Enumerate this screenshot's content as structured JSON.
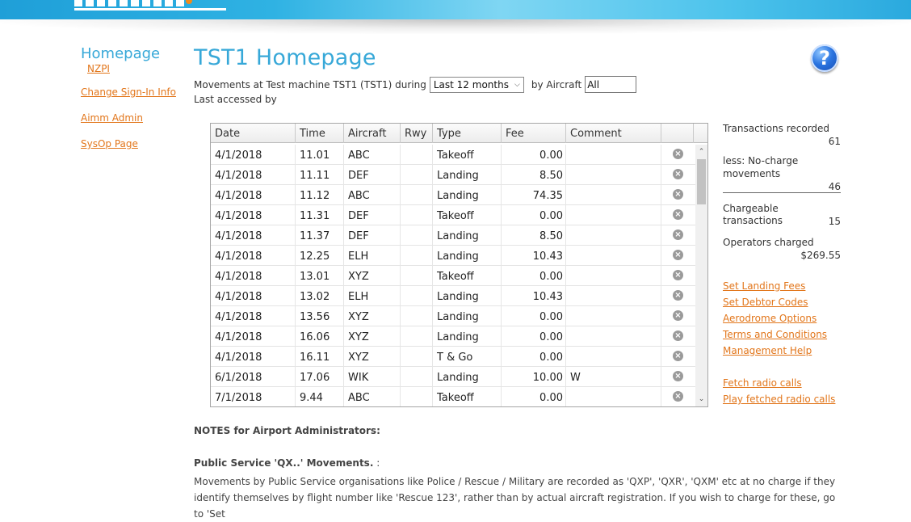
{
  "sidebar": {
    "homepage": "Homepage",
    "airport_code": "NZPI",
    "links": [
      "Change Sign-In Info",
      "Aimm Admin",
      "SysOp Page"
    ]
  },
  "header": {
    "title": "TST1 Homepage",
    "movements_prefix": "Movements at Test machine TST1 (TST1) during",
    "period_value": "Last 12 months",
    "by_aircraft_label": "by Aircraft",
    "aircraft_value": "All",
    "last_accessed": "Last accessed by"
  },
  "table": {
    "columns": [
      "Date",
      "Time",
      "Aircraft",
      "Rwy",
      "Type",
      "Fee",
      "Comment"
    ],
    "rows": [
      {
        "date": "4/1/2018",
        "time": "11.01",
        "aircraft": "ABC",
        "rwy": "",
        "type": "Takeoff",
        "fee": "0.00",
        "comment": ""
      },
      {
        "date": "4/1/2018",
        "time": "11.11",
        "aircraft": "DEF",
        "rwy": "",
        "type": "Landing",
        "fee": "8.50",
        "comment": ""
      },
      {
        "date": "4/1/2018",
        "time": "11.12",
        "aircraft": "ABC",
        "rwy": "",
        "type": "Landing",
        "fee": "74.35",
        "comment": ""
      },
      {
        "date": "4/1/2018",
        "time": "11.31",
        "aircraft": "DEF",
        "rwy": "",
        "type": "Takeoff",
        "fee": "0.00",
        "comment": ""
      },
      {
        "date": "4/1/2018",
        "time": "11.37",
        "aircraft": "DEF",
        "rwy": "",
        "type": "Landing",
        "fee": "8.50",
        "comment": ""
      },
      {
        "date": "4/1/2018",
        "time": "12.25",
        "aircraft": "ELH",
        "rwy": "",
        "type": "Landing",
        "fee": "10.43",
        "comment": ""
      },
      {
        "date": "4/1/2018",
        "time": "13.01",
        "aircraft": "XYZ",
        "rwy": "",
        "type": "Takeoff",
        "fee": "0.00",
        "comment": ""
      },
      {
        "date": "4/1/2018",
        "time": "13.02",
        "aircraft": "ELH",
        "rwy": "",
        "type": "Landing",
        "fee": "10.43",
        "comment": ""
      },
      {
        "date": "4/1/2018",
        "time": "13.56",
        "aircraft": "XYZ",
        "rwy": "",
        "type": "Landing",
        "fee": "0.00",
        "comment": ""
      },
      {
        "date": "4/1/2018",
        "time": "16.06",
        "aircraft": "XYZ",
        "rwy": "",
        "type": "Landing",
        "fee": "0.00",
        "comment": ""
      },
      {
        "date": "4/1/2018",
        "time": "16.11",
        "aircraft": "XYZ",
        "rwy": "",
        "type": "T & Go",
        "fee": "0.00",
        "comment": ""
      },
      {
        "date": "6/1/2018",
        "time": "17.06",
        "aircraft": "WIK",
        "rwy": "",
        "type": "Landing",
        "fee": "10.00",
        "comment": "W"
      },
      {
        "date": "7/1/2018",
        "time": "9.44",
        "aircraft": "ABC",
        "rwy": "",
        "type": "Takeoff",
        "fee": "0.00",
        "comment": ""
      }
    ]
  },
  "summary": {
    "transactions_label": "Transactions recorded",
    "transactions_value": "61",
    "nocharge_label_1": "less: No-charge",
    "nocharge_label_2": "movements",
    "nocharge_value": "46",
    "chargeable_label": "Chargeable transactions",
    "chargeable_value": "15",
    "operators_label": "Operators charged",
    "operators_value": "$269.55"
  },
  "right_links": [
    "Set Landing Fees",
    "Set Debtor Codes",
    "Aerodrome Options",
    "Terms and Conditions",
    "Management Help",
    "Fetch radio calls",
    "Play fetched radio calls"
  ],
  "notes": {
    "heading": "NOTES for Airport Administrators:",
    "qx_heading": "Public Service 'QX..' Movements.",
    "qx_suffix": " :",
    "body": "Movements by Public Service organisations like Police / Rescue / Military are recorded as 'QXP', 'QXR', 'QXM' etc at no charge if they identify themselves by flight number like 'Rescue 123', rather than by actual aircraft registration. If you wish to charge for these, go to 'Set"
  },
  "icons": {
    "help": "help-question-icon",
    "delete": "delete-circle-x-icon",
    "select_arrow": "chevron-down-icon"
  },
  "colors": {
    "accent_blue": "#37a8d8",
    "link_orange": "#e2761b"
  }
}
